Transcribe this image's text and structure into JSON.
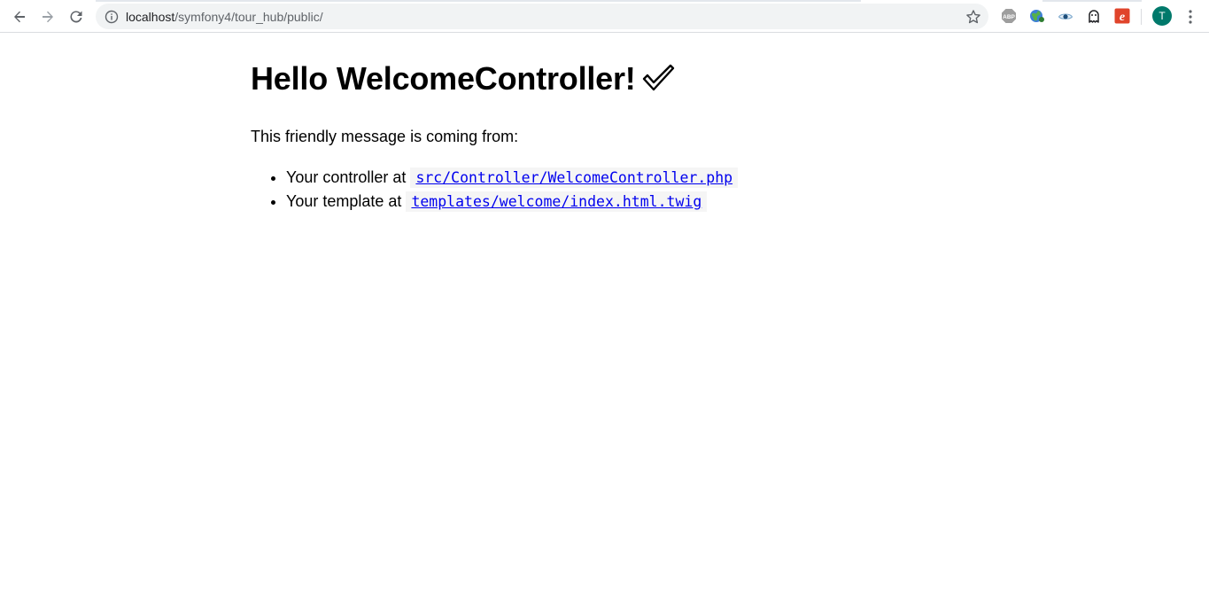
{
  "browser": {
    "url_host": "localhost",
    "url_path": "/symfony4/tour_hub/public/",
    "profile_initial": "T",
    "extensions": [
      "adblock-plus-icon",
      "globe-extension-icon",
      "eye-extension-icon",
      "ghost-extension-icon",
      "e-extension-icon"
    ],
    "colors": {
      "avatar": "#00796b",
      "e_extension": "#e0442b"
    }
  },
  "page": {
    "heading": "Hello WelcomeController!",
    "intro": "This friendly message is coming from:",
    "items": [
      {
        "label": "Your controller at",
        "path": "src/Controller/WelcomeController.php"
      },
      {
        "label": "Your template at",
        "path": "templates/welcome/index.html.twig"
      }
    ]
  }
}
